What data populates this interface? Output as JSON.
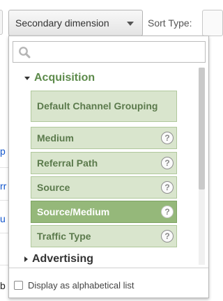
{
  "header": {
    "secondary_dimension_label": "Secondary dimension",
    "sort_type_label": "Sort Type:"
  },
  "background": {
    "snippets": [
      "p",
      "rr",
      "u",
      "b"
    ]
  },
  "dropdown": {
    "search": {
      "value": "",
      "placeholder": ""
    },
    "groups": [
      {
        "label": "Acquisition",
        "expanded": true,
        "items": [
          {
            "label": "Default Channel Grouping",
            "help": false,
            "selected": false
          },
          {
            "label": "Medium",
            "help": true,
            "selected": false
          },
          {
            "label": "Referral Path",
            "help": true,
            "selected": false
          },
          {
            "label": "Source",
            "help": true,
            "selected": false
          },
          {
            "label": "Source/Medium",
            "help": true,
            "selected": true
          },
          {
            "label": "Traffic Type",
            "help": true,
            "selected": false
          }
        ]
      },
      {
        "label": "Advertising",
        "expanded": false
      }
    ],
    "help_glyph": "?",
    "alphabetical_checkbox": {
      "label": "Display as alphabetical list",
      "checked": false
    }
  },
  "colors": {
    "item_background": "#d9e5cd",
    "item_text": "#5b7a4c",
    "selected_background": "#95b87a",
    "group_heading": "#5c8a4a"
  }
}
